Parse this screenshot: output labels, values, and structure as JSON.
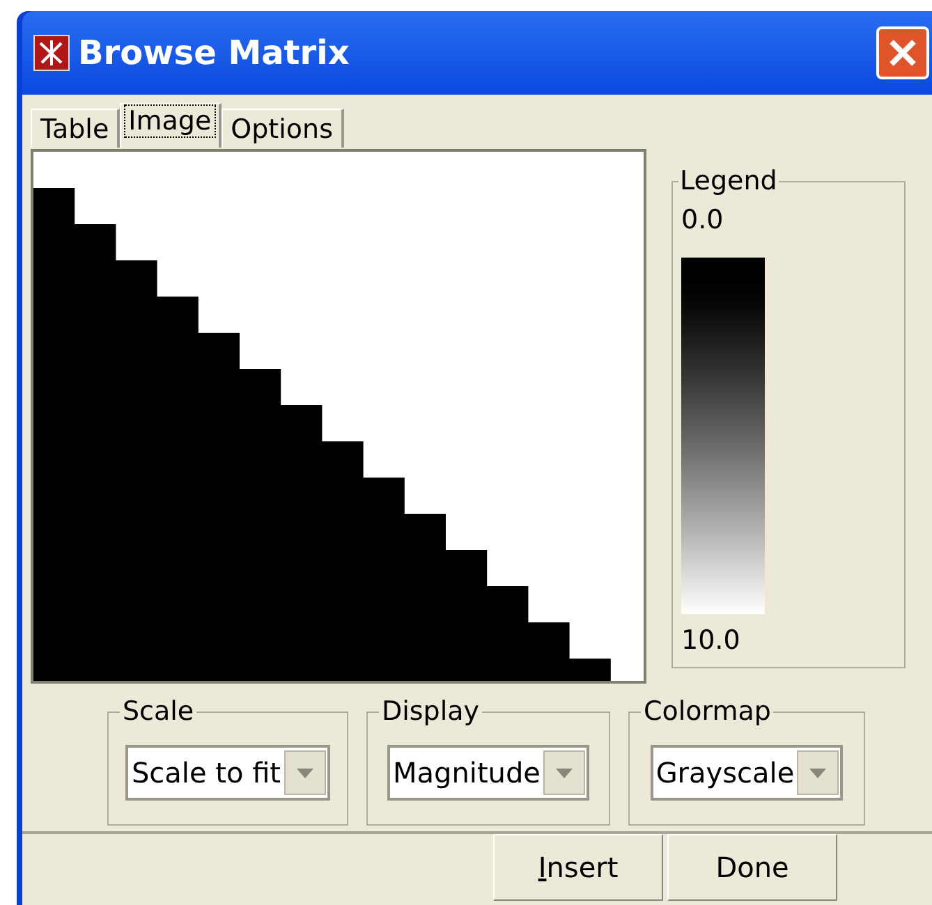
{
  "window": {
    "title": "Browse Matrix"
  },
  "tabs": [
    {
      "label": "Table",
      "selected": false
    },
    {
      "label": "Image",
      "selected": true
    },
    {
      "label": "Options",
      "selected": false
    }
  ],
  "legend": {
    "title": "Legend",
    "top_value": "0.0",
    "bottom_value": "10.0"
  },
  "settings": [
    {
      "label": "Scale",
      "value": "Scale to fit"
    },
    {
      "label": "Display",
      "value": "Magnitude"
    },
    {
      "label": "Colormap",
      "value": "Grayscale"
    }
  ],
  "buttons": [
    {
      "label": "Insert",
      "mnemonic_first": true
    },
    {
      "label": "Done",
      "mnemonic_first": false
    }
  ]
}
